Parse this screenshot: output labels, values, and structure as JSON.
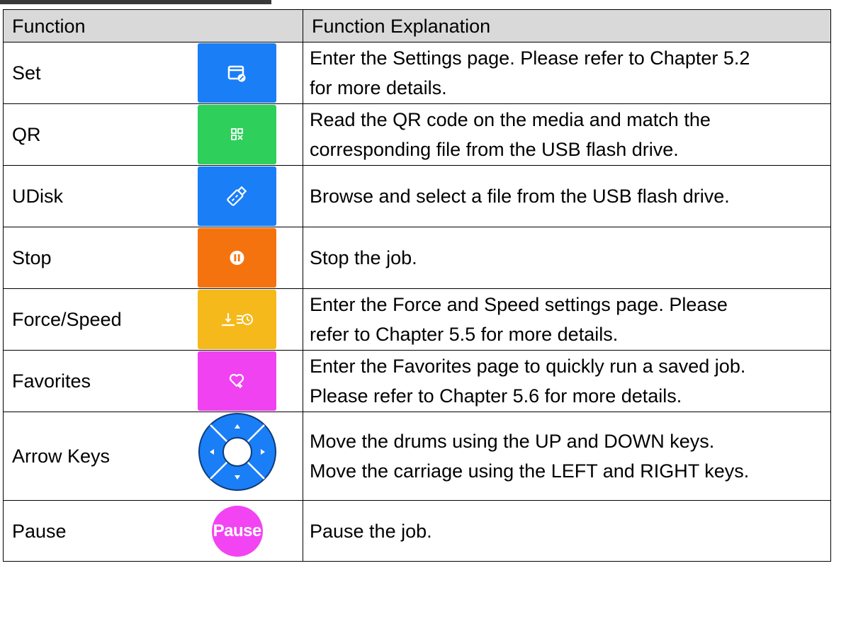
{
  "header": {
    "function": "Function",
    "explanation": "Function Explanation"
  },
  "rows": [
    {
      "name": "Set",
      "icon": "settings-edit-icon",
      "color": "#1a7ef7",
      "lines": [
        "Enter the Settings page. Please refer to Chapter 5.2",
        "for more details."
      ]
    },
    {
      "name": "QR",
      "icon": "qr-scan-icon",
      "color": "#2ecf5b",
      "lines": [
        "Read the QR code on the media and match the",
        "corresponding file from the USB flash drive."
      ]
    },
    {
      "name": "UDisk",
      "icon": "usb-drive-icon",
      "color": "#1a7ef7",
      "lines": [
        "Browse and select a file from the USB flash drive."
      ]
    },
    {
      "name": "Stop",
      "icon": "stop-icon",
      "color": "#f5730f",
      "lines": [
        "Stop the job."
      ]
    },
    {
      "name": "Force/Speed",
      "icon": "force-speed-icon",
      "color": "#f6b91b",
      "lines": [
        "Enter the Force and Speed settings page. Please",
        "refer to Chapter 5.5 for more details."
      ]
    },
    {
      "name": "Favorites",
      "icon": "heart-add-icon",
      "color": "#f142f1",
      "lines": [
        "Enter the Favorites page to quickly run a saved job.",
        "Please refer to Chapter 5.6 for more details."
      ]
    },
    {
      "name": "Arrow Keys",
      "icon": "arrow-pad-icon",
      "color": "#1a7ef7",
      "lines": [
        "Move the drums using the UP and DOWN keys.",
        "Move the carriage using the LEFT and RIGHT keys."
      ]
    },
    {
      "name": "Pause",
      "icon": "pause-button-icon",
      "color": "#f244f2",
      "icon_text": "Pause",
      "lines": [
        "Pause the job."
      ]
    }
  ]
}
